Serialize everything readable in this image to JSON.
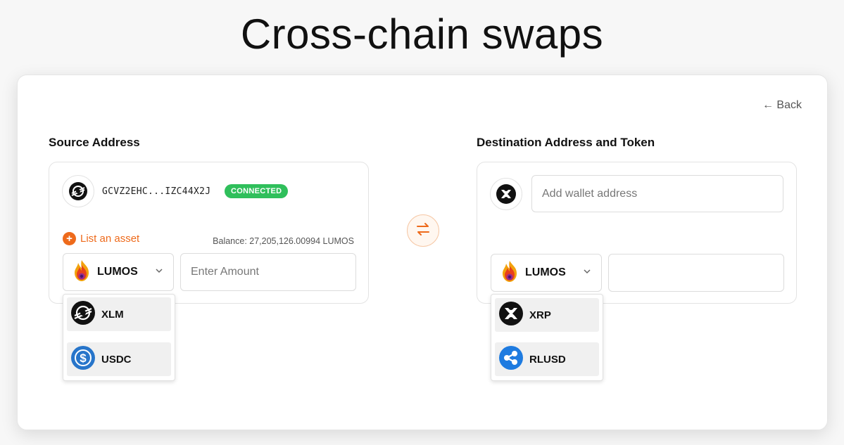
{
  "page": {
    "title": "Cross-chain swaps"
  },
  "nav": {
    "back_label": "← Back"
  },
  "source": {
    "title": "Source Address",
    "wallet_address": "GCVZ2EHC...IZC44X2J",
    "status_badge": "CONNECTED",
    "list_asset_label": "List an asset",
    "balance_text": "Balance: 27,205,126.00994 LUMOS",
    "selected_token": "LUMOS",
    "amount_placeholder": "Enter Amount",
    "token_options": [
      {
        "symbol": "XLM",
        "icon": "stellar-icon"
      },
      {
        "symbol": "USDC",
        "icon": "usdc-icon"
      }
    ]
  },
  "destination": {
    "title": "Destination Address and Token",
    "address_placeholder": "Add wallet address",
    "selected_token": "LUMOS",
    "amount_value": "",
    "token_options": [
      {
        "symbol": "XRP",
        "icon": "xrp-icon"
      },
      {
        "symbol": "RLUSD",
        "icon": "ripple-icon"
      }
    ]
  },
  "colors": {
    "accent": "#ee6a1b",
    "connected": "#2fbf5b",
    "usdc": "#2775ca",
    "ripple": "#1e7be0"
  }
}
